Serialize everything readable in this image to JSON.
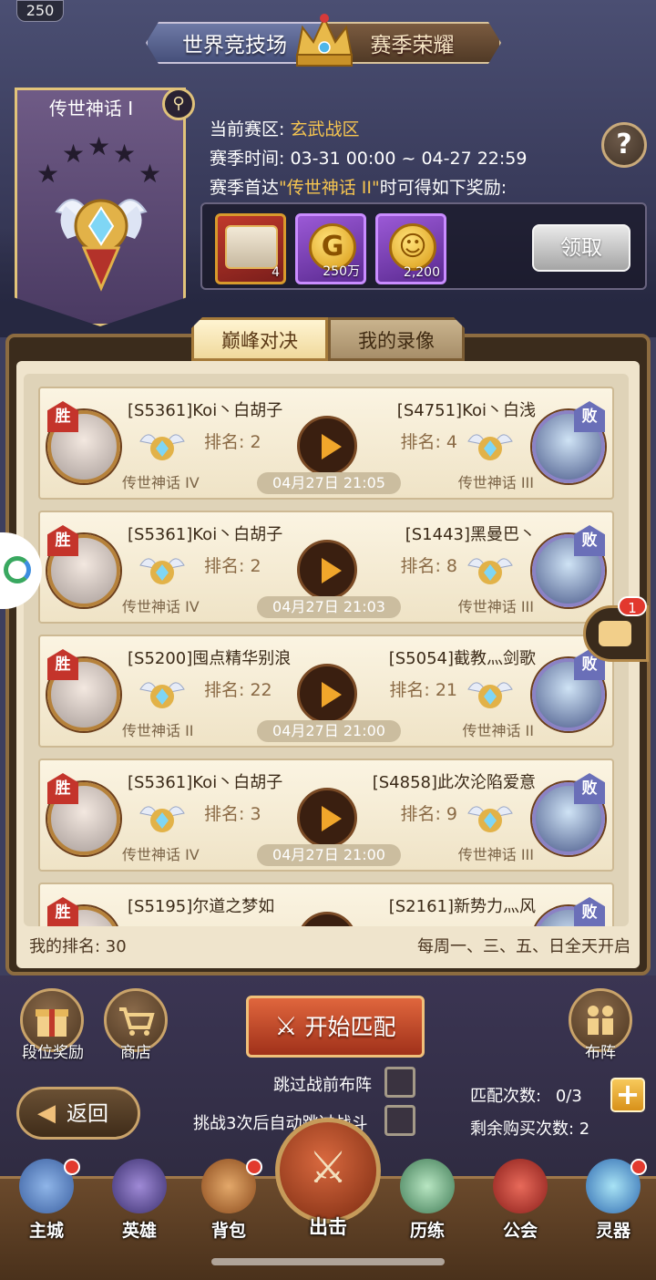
{
  "header": {
    "level": "250",
    "tab_left": "世界竞技场",
    "tab_right": "赛季荣耀"
  },
  "rank": {
    "name": "传世神话 I",
    "stars": 5
  },
  "season": {
    "zone_label": "当前赛区:",
    "zone_value": "玄武战区",
    "time_label": "赛季时间:",
    "time_value": "03-31 00:00 ~ 04-27 22:59",
    "reward_prefix": "赛季首达",
    "reward_target": "\"传世神话 II\"",
    "reward_suffix": "时可得如下奖励:"
  },
  "rewards": [
    {
      "qty": "4"
    },
    {
      "qty": "250万",
      "glyph": "G"
    },
    {
      "qty": "2,200"
    }
  ],
  "claim_label": "领取",
  "tabs": {
    "active": "巅峰对决",
    "inactive": "我的录像"
  },
  "result_labels": {
    "win": "胜",
    "lose": "败"
  },
  "rank_label": "排名:",
  "matches": [
    {
      "left_name": "[S5361]Koi丶白胡子",
      "left_rank": "2",
      "left_tier": "传世神话 IV",
      "right_name": "[S4751]Koi丶白浅",
      "right_rank": "4",
      "right_tier": "传世神话 III",
      "time": "04月27日 21:05"
    },
    {
      "left_name": "[S5361]Koi丶白胡子",
      "left_rank": "2",
      "left_tier": "传世神话 IV",
      "right_name": "[S1443]黑曼巴丶",
      "right_rank": "8",
      "right_tier": "传世神话 III",
      "time": "04月27日 21:03"
    },
    {
      "left_name": "[S5200]囤点精华别浪",
      "left_rank": "22",
      "left_tier": "传世神话 II",
      "right_name": "[S5054]截教灬剑歌",
      "right_rank": "21",
      "right_tier": "传世神话 II",
      "time": "04月27日 21:00"
    },
    {
      "left_name": "[S5361]Koi丶白胡子",
      "left_rank": "3",
      "left_tier": "传世神话 IV",
      "right_name": "[S4858]此次沦陷爱意",
      "right_rank": "9",
      "right_tier": "传世神话 III",
      "time": "04月27日 21:00"
    },
    {
      "left_name": "[S5195]尔道之梦如",
      "right_name": "[S2161]新势力灬风"
    }
  ],
  "footer": {
    "my_rank": "我的排名: 30",
    "open_days": "每周一、三、五、日全天开启"
  },
  "chat_badge": "1",
  "actions": {
    "rank_reward": "段位奖励",
    "shop": "商店",
    "formation": "布阵",
    "start_match": "开始匹配",
    "skip_prebattle": "跳过战前布阵",
    "auto_skip": "挑战3次后自动跳过战斗",
    "back": "返回",
    "match_count_label": "匹配次数:",
    "match_count_value": "0/3",
    "remain_buy": "剩余购买次数: 2"
  },
  "nav": {
    "main_city": "主城",
    "hero": "英雄",
    "bag": "背包",
    "attack": "出击",
    "training": "历练",
    "guild": "公会",
    "artifact": "灵器"
  },
  "colors": {
    "accent_gold": "#f6c550",
    "win_red": "#c4342b",
    "lose_blue": "#6a6fb8",
    "start_button": "#c8482a"
  }
}
